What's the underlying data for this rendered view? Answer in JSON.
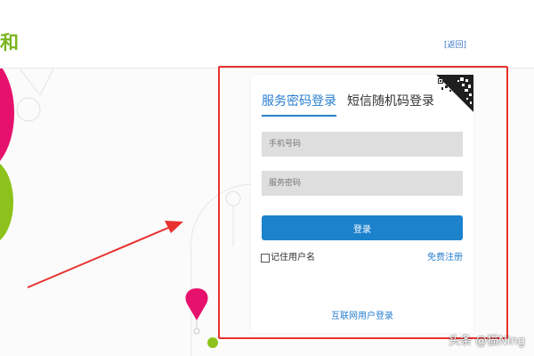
{
  "header": {
    "logo_fragment": "和",
    "back_link": "[返回]"
  },
  "login": {
    "tabs": [
      {
        "label": "服务密码登录",
        "active": true
      },
      {
        "label": "短信随机码登录",
        "active": false
      }
    ],
    "phone_placeholder": "手机号码",
    "password_placeholder": "服务密码",
    "submit_label": "登录",
    "remember_label": "记住用户名",
    "register_label": "免费注册",
    "internet_login_label": "互联网用户登录",
    "qr_icon": "qr-code-icon"
  },
  "annotation": {
    "frame_color": "#e8322f",
    "arrow_color": "#e8322f"
  },
  "watermark": "头条 @猫Ning",
  "colors": {
    "brand_green": "#7ab51d",
    "accent_blue": "#1c82cc",
    "link_blue": "#2a7fcf",
    "magenta": "#e6116c",
    "lime": "#8cc21b"
  }
}
